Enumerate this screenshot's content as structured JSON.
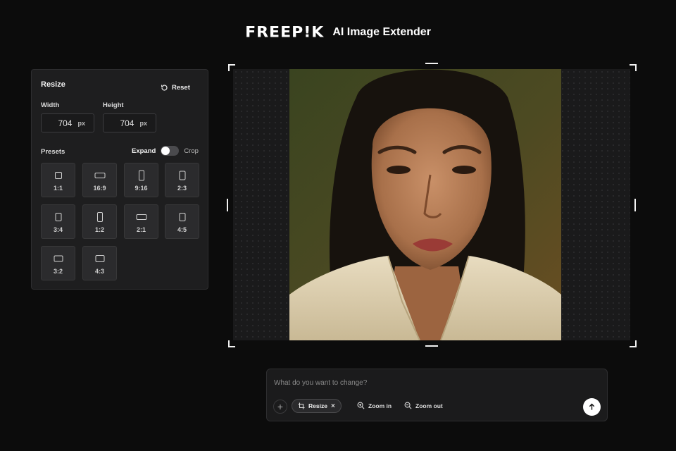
{
  "header": {
    "logo": "FREEP!K",
    "title": "AI Image Extender"
  },
  "resize_panel": {
    "title": "Resize",
    "reset_label": "Reset",
    "width_label": "Width",
    "height_label": "Height",
    "width_value": "704",
    "height_value": "704",
    "unit": "px",
    "presets_label": "Presets",
    "expand_label": "Expand",
    "crop_label": "Crop",
    "toggle_mode": "Expand",
    "presets": [
      {
        "label": "1:1"
      },
      {
        "label": "16:9"
      },
      {
        "label": "9:16"
      },
      {
        "label": "2:3"
      },
      {
        "label": "3:4"
      },
      {
        "label": "1:2"
      },
      {
        "label": "2:1"
      },
      {
        "label": "4:5"
      },
      {
        "label": "3:2"
      },
      {
        "label": "4:3"
      }
    ]
  },
  "prompt": {
    "placeholder": "What do you want to change?",
    "chip_label": "Resize",
    "zoom_in_label": "Zoom in",
    "zoom_out_label": "Zoom out"
  },
  "colors": {
    "background": "#0c0c0c",
    "panel": "#1e1e1f",
    "accent": "#ffffff"
  }
}
